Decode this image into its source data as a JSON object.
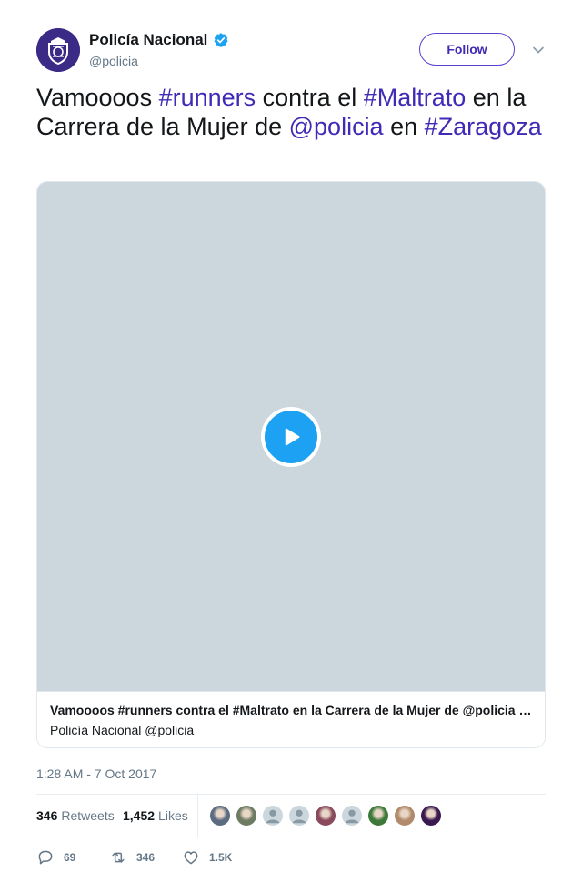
{
  "account": {
    "display_name": "Policía Nacional",
    "handle": "@policia",
    "follow_label": "Follow"
  },
  "tweet": {
    "segments": [
      {
        "text": "Vamoooos ",
        "link": false
      },
      {
        "text": "#runners",
        "link": true
      },
      {
        "text": " contra el ",
        "link": false
      },
      {
        "text": "#Maltrato",
        "link": true
      },
      {
        "text": " en la Carrera de la Mujer de ",
        "link": false
      },
      {
        "text": "@policia",
        "link": true
      },
      {
        "text": " en ",
        "link": false
      },
      {
        "text": "#Zaragoza",
        "link": true
      }
    ]
  },
  "card": {
    "title": "Vamoooos #runners contra el #Maltrato en la Carrera de la Mujer de @policia en #Zaragoza",
    "byline": "Policía Nacional @policia"
  },
  "timestamp": "1:28 AM - 7 Oct 2017",
  "stats": {
    "retweets_count": "346",
    "retweets_label": "Retweets",
    "likes_count": "1,452",
    "likes_label": "Likes",
    "likers": [
      "#5b6b80",
      "#6e7b63",
      "#ccd6dd",
      "#ccd6dd",
      "#8a4a5c",
      "#ccd6dd",
      "#3d7a3a",
      "#b08a6a",
      "#3a1850"
    ]
  },
  "actions": {
    "replies": "69",
    "retweets": "346",
    "likes": "1.5K"
  },
  "colors": {
    "link": "#3f2bb5",
    "verified": "#1da1f2",
    "play": "#1da1f2",
    "media_placeholder": "#ccd6dd"
  },
  "icons": {
    "verified": "verified-badge-icon",
    "caret": "chevron-down-icon",
    "play": "play-icon",
    "reply": "reply-icon",
    "retweet": "retweet-icon",
    "like": "heart-icon"
  }
}
